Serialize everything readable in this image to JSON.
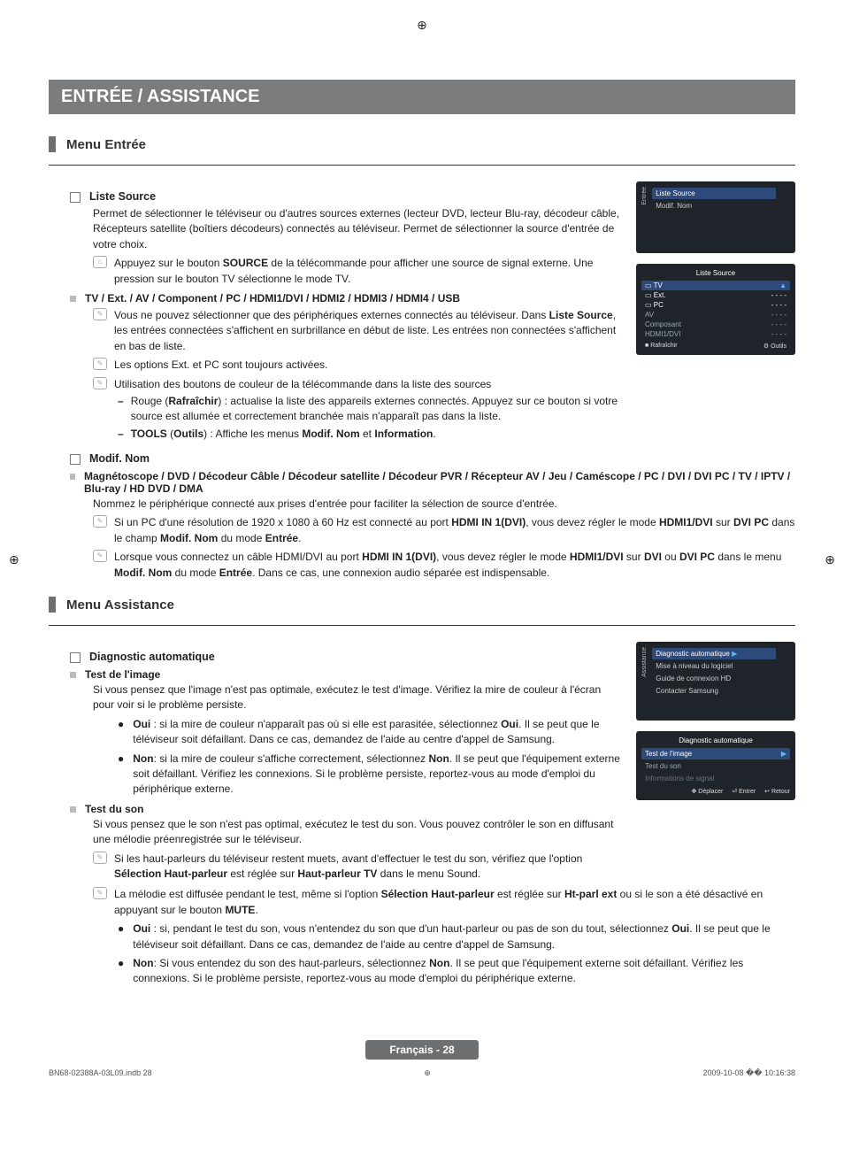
{
  "header": {
    "title": "ENTRÉE / ASSISTANCE"
  },
  "section1": {
    "title": "Menu Entrée"
  },
  "liste_source": {
    "heading": "Liste Source",
    "p1": "Permet de sélectionner le téléviseur ou d'autres sources externes (lecteur DVD, lecteur Blu-ray, décodeur câble,",
    "p2": "Récepteurs satellite (boîtiers décodeurs) connectés au téléviseur. Permet de sélectionner la source d'entrée de votre choix.",
    "note1a": "Appuyez sur le bouton ",
    "note1b": "SOURCE",
    "note1c": " de la télécommande pour afficher une source de signal externe. Une pression sur le bouton TV sélectionne le mode TV.",
    "sub1": "TV / Ext. / AV / Component / PC / HDMI1/DVI / HDMI2 / HDMI3 / HDMI4 / USB",
    "n2a": "Vous ne pouvez sélectionner que des périphériques externes connectés au téléviseur. Dans ",
    "n2b": "Liste Source",
    "n2c": ", les entrées connectées s'affichent en surbrillance en début de liste. Les entrées non connectées s'affichent en bas de liste.",
    "n3": "Les options Ext. et PC sont toujours activées.",
    "n4": "Utilisation des boutons de couleur de la télécommande dans la liste des sources",
    "d1a": "Rouge (",
    "d1b": "Rafraîchir",
    "d1c": ") : actualise la liste des appareils externes connectés. Appuyez sur ce bouton si votre source est allumée et correctement branchée mais n'apparaît pas dans la liste.",
    "d2a": "TOOLS",
    "d2b": " (",
    "d2c": "Outils",
    "d2d": ") : Affiche les menus ",
    "d2e": "Modif. Nom",
    "d2f": " et ",
    "d2g": "Information",
    "d2h": "."
  },
  "modif_nom": {
    "heading": "Modif. Nom",
    "sub": "Magnétoscope / DVD / Décodeur Câble / Décodeur satellite / Décodeur PVR / Récepteur AV / Jeu / Caméscope / PC / DVI / DVI PC / TV / IPTV / Blu-ray / HD DVD / DMA",
    "p1": "Nommez le périphérique connecté aux prises d'entrée pour faciliter la sélection de source d'entrée.",
    "n1a": "Si un PC d'une résolution de 1920 x 1080 à 60 Hz est connecté au port ",
    "n1b": "HDMI IN 1(DVI)",
    "n1c": ", vous devez régler le mode ",
    "n1d": "HDMI1/DVI",
    "n1e": " sur ",
    "n1f": "DVI PC",
    "n1g": " dans le champ ",
    "n1h": "Modif. Nom",
    "n1i": " du mode ",
    "n1j": "Entrée",
    "n1k": ".",
    "n2a": "Lorsque vous connectez un câble HDMI/DVI au port ",
    "n2b": "HDMI IN 1(DVI)",
    "n2c": ", vous devez régler le mode ",
    "n2d": "HDMI1/DVI",
    "n2e": " sur ",
    "n2f": "DVI",
    "n2g": " ou ",
    "n2h": "DVI PC",
    "n2i": " dans le menu ",
    "n2j": "Modif. Nom",
    "n2k": " du mode ",
    "n2l": "Entrée",
    "n2m": ". Dans ce cas, une connexion audio séparée est indispensable."
  },
  "section2": {
    "title": "Menu Assistance"
  },
  "diag": {
    "heading": "Diagnostic automatique",
    "sub1": "Test de l'image",
    "p1": "Si vous pensez que l'image n'est pas optimale, exécutez le test d'image. Vérifiez la mire de couleur à l'écran pour voir si le problème persiste.",
    "b1a": "Oui",
    "b1b": " : si la mire de couleur n'apparaît pas où si elle est parasitée, sélectionnez ",
    "b1c": "Oui",
    "b1d": ". Il se peut que le téléviseur soit défaillant. Dans ce cas, demandez de l'aide au centre d'appel de Samsung.",
    "b2a": "Non",
    "b2b": ": si la mire de couleur s'affiche correctement, sélectionnez ",
    "b2c": "Non",
    "b2d": ". Il se peut que l'équipement externe soit défaillant. Vérifiez les connexions. Si le problème persiste, reportez-vous au mode d'emploi du périphérique externe.",
    "sub2": "Test du son",
    "p2": "Si vous pensez que le son n'est pas optimal, exécutez le test du son. Vous pouvez contrôler le son en diffusant une mélodie préenregistrée sur le téléviseur.",
    "n1a": "Si les haut-parleurs du téléviseur restent muets, avant d'effectuer le test du son, vérifiez que l'option ",
    "n1b": "Sélection Haut-parleur",
    "n1c": " est réglée sur ",
    "n1d": "Haut-parleur TV",
    "n1e": " dans le menu Sound.",
    "n2a": "La mélodie est diffusée pendant le test, même si l'option ",
    "n2b": "Sélection Haut-parleur",
    "n2c": " est réglée sur ",
    "n2d": "Ht-parl ext",
    "n2e": " ou si le son a été désactivé en appuyant sur le bouton ",
    "n2f": "MUTE",
    "n2g": ".",
    "b3a": "Oui",
    "b3b": " : si, pendant le test du son, vous n'entendez du son que d'un haut-parleur ou pas de son du tout, sélectionnez ",
    "b3c": "Oui",
    "b3d": ". Il se peut que le téléviseur soit défaillant. Dans ce cas, demandez de l'aide au centre d'appel de Samsung.",
    "b4a": "Non",
    "b4b": ": Si vous entendez du son des haut-parleurs, sélectionnez ",
    "b4c": "Non",
    "b4d": ". Il se peut que l'équipement externe soit défaillant. Vérifiez les connexions. Si le problème persiste, reportez-vous au mode d'emploi du périphérique externe."
  },
  "osd1": {
    "side": "Entrée",
    "i1": "Liste Source",
    "i2": "Modif. Nom"
  },
  "osd2": {
    "title": "Liste Source",
    "r1": "TV",
    "r2": "Ext.",
    "r2v": "- - - -",
    "r3": "PC",
    "r3v": "- - - -",
    "r4": "AV",
    "r4v": "- - - -",
    "r5": "Composant",
    "r5v": "- - - -",
    "r6": "HDMI1/DVI",
    "r6v": "- - - -",
    "f1": "Rafraîchir",
    "f2": "Outils"
  },
  "osd3": {
    "side": "Assistance",
    "i1": "Diagnostic automatique",
    "i2": "Mise à niveau du logiciel",
    "i3": "Guide de connexion HD",
    "i4": "Contacter Samsung"
  },
  "osd4": {
    "title": "Diagnostic automatique",
    "r1": "Test de l'image",
    "r2": "Test du son",
    "r3": "Informations de signal",
    "f1": "Déplacer",
    "f2": "Entrer",
    "f3": "Retour"
  },
  "footer": {
    "badge": "Français - 28",
    "left": "BN68-02388A-03L09.indb   28",
    "right": "2009-10-08   �� 10:16:38"
  }
}
